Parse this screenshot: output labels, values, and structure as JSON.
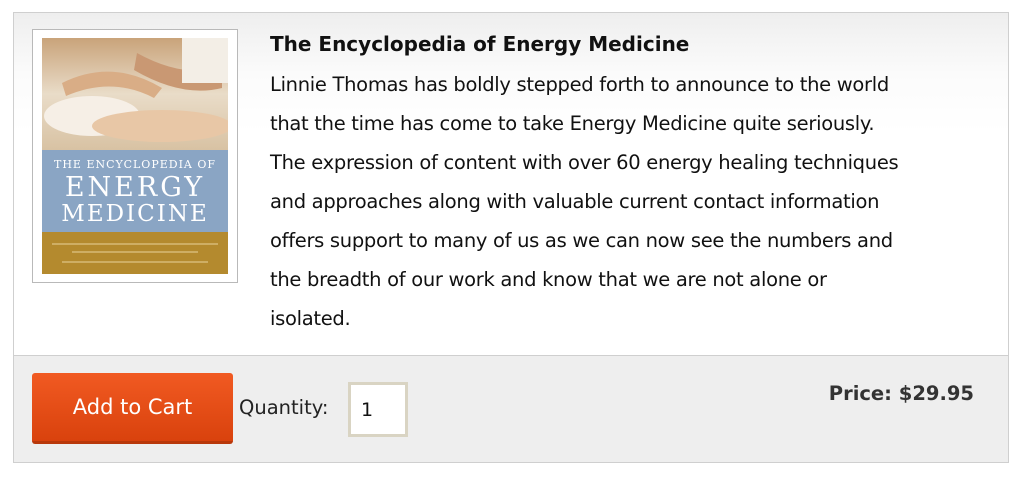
{
  "product": {
    "title": "The Encyclopedia of Energy Medicine",
    "description_lines": [
      "Linnie Thomas has boldly stepped forth to announce to the world",
      "that the time has come to take Energy Medicine quite seriously.",
      "The expression of content with over 60 energy healing techniques",
      "and approaches along with valuable current contact information",
      "offers support to many of us as we can now see the numbers and",
      "the breadth of our work and know that we are not alone or",
      "isolated."
    ],
    "cover": {
      "line1": "THE ENCYCLOPEDIA OF",
      "line2": "ENERGY",
      "line3": "MEDICINE"
    }
  },
  "purchase": {
    "add_to_cart_label": "Add to Cart",
    "quantity_label": "Quantity:",
    "quantity_value": "1",
    "price_text": "Price: $29.95"
  },
  "colors": {
    "button": "#e8501a",
    "price_text": "#333333",
    "cover_blue": "#8aa5c4",
    "cover_gold": "#b48a2e"
  }
}
